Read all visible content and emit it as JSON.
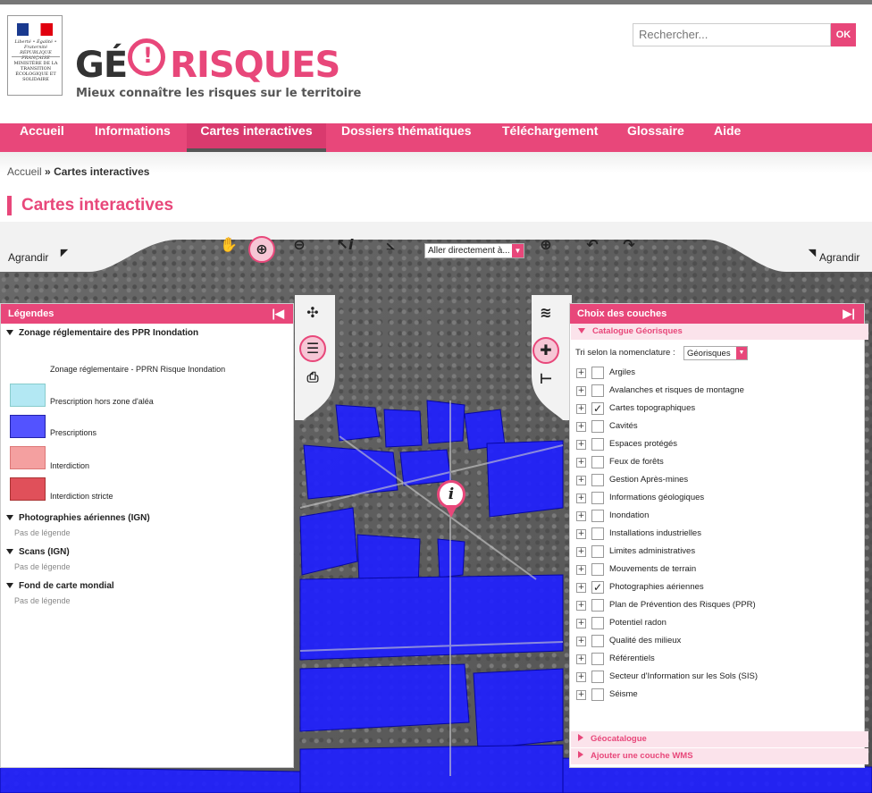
{
  "header": {
    "ministry_motto": "Liberté • Égalité • Fraternité RÉPUBLIQUE FRANÇAISE",
    "ministry_name": "MINISTÈRE DE LA TRANSITION ÉCOLOGIQUE ET SOLIDAIRE",
    "logo_part1": "GÉ",
    "logo_part2": "RISQUES",
    "logo_exclaim": "!",
    "tagline": "Mieux connaître les risques sur le territoire",
    "search_placeholder": "Rechercher...",
    "search_button": "OK"
  },
  "nav": {
    "items": [
      "Accueil",
      "Informations",
      "Cartes interactives",
      "Dossiers thématiques",
      "Téléchargement",
      "Glossaire",
      "Aide"
    ],
    "active": "Cartes interactives"
  },
  "breadcrumb": {
    "home": "Accueil",
    "sep": "»",
    "current": "Cartes interactives"
  },
  "page_title": "Cartes interactives",
  "toolbar": {
    "left_label": "Agrandir",
    "right_label": "Agrandir",
    "goto_select": "Aller directement à...",
    "tools": [
      "hand-icon",
      "zoom-in-icon",
      "zoom-out-icon",
      "info-select-icon",
      "measure-icon",
      "globe-icon",
      "undo-icon",
      "redo-icon"
    ]
  },
  "legend_panel": {
    "title": "Légendes",
    "groups": [
      {
        "name": "Zonage réglementaire des PPR Inondation"
      },
      {
        "name": "Photographies aériennes (IGN)",
        "none": "Pas de légende"
      },
      {
        "name": "Scans (IGN)",
        "none": "Pas de légende"
      },
      {
        "name": "Fond de carte mondial",
        "none": "Pas de légende"
      }
    ],
    "sub_title": "Zonage réglementaire - PPRN Risque Inondation",
    "swatches": [
      {
        "label": "Prescription hors zone d'aléa",
        "color": "#b3e8f3"
      },
      {
        "label": "Prescriptions",
        "color": "#5353ff"
      },
      {
        "label": "Interdiction",
        "color": "#f4a0a0"
      },
      {
        "label": "Interdiction stricte",
        "color": "#e0505a"
      }
    ]
  },
  "layers_panel": {
    "title": "Choix des couches",
    "catalog": "Catalogue Géorisques",
    "sort_label": "Tri selon la nomenclature :",
    "sort_value": "Géorisques",
    "items": [
      {
        "label": "Argiles",
        "checked": false
      },
      {
        "label": "Avalanches et risques de montagne",
        "checked": false
      },
      {
        "label": "Cartes topographiques",
        "checked": true
      },
      {
        "label": "Cavités",
        "checked": false
      },
      {
        "label": "Espaces protégés",
        "checked": false
      },
      {
        "label": "Feux de forêts",
        "checked": false
      },
      {
        "label": "Gestion Après-mines",
        "checked": false
      },
      {
        "label": "Informations géologiques",
        "checked": false
      },
      {
        "label": "Inondation",
        "checked": false
      },
      {
        "label": "Installations industrielles",
        "checked": false
      },
      {
        "label": "Limites administratives",
        "checked": false
      },
      {
        "label": "Mouvements de terrain",
        "checked": false
      },
      {
        "label": "Photographies aériennes",
        "checked": true
      },
      {
        "label": "Plan de Prévention des Risques (PPR)",
        "checked": false
      },
      {
        "label": "Potentiel radon",
        "checked": false
      },
      {
        "label": "Qualité des milieux",
        "checked": false
      },
      {
        "label": "Référentiels",
        "checked": false
      },
      {
        "label": "Secteur d'Information sur les Sols (SIS)",
        "checked": false
      },
      {
        "label": "Séisme",
        "checked": false
      }
    ],
    "geocatalogue": "Géocatalogue",
    "add_wms": "Ajouter une couche WMS"
  },
  "map": {
    "marker_label": "i",
    "flood_color": "#2020ff"
  },
  "colors": {
    "accent": "#e8477a"
  }
}
